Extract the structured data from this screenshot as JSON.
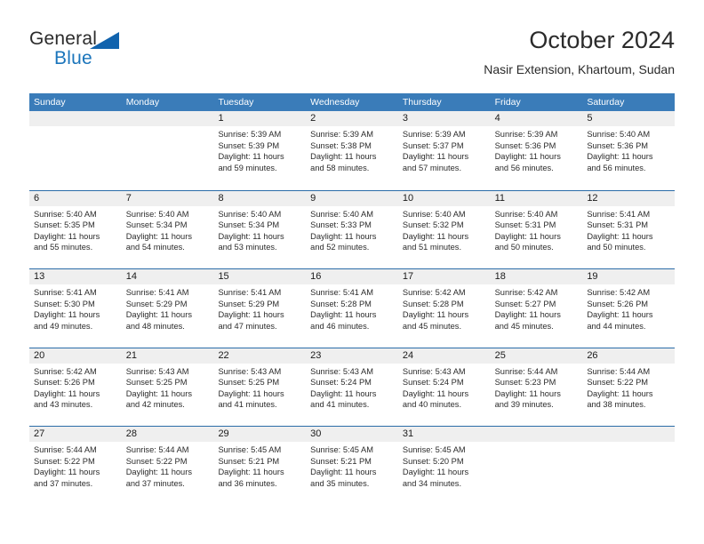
{
  "brand": {
    "name_part1": "General",
    "name_part2": "Blue",
    "triangle_color": "#1163ad",
    "blue_color": "#1b75bb"
  },
  "header": {
    "title": "October 2024",
    "subtitle": "Nasir Extension, Khartoum, Sudan"
  },
  "theme": {
    "header_row_bg": "#3a7cb9",
    "header_row_text": "#ffffff",
    "week_separator": "#2b6ca8",
    "day_band_bg": "#efefef",
    "body_text": "#2b2b2b"
  },
  "weekdays": [
    "Sunday",
    "Monday",
    "Tuesday",
    "Wednesday",
    "Thursday",
    "Friday",
    "Saturday"
  ],
  "weeks": [
    [
      {
        "day": "",
        "lines": []
      },
      {
        "day": "",
        "lines": []
      },
      {
        "day": "1",
        "lines": [
          "Sunrise: 5:39 AM",
          "Sunset: 5:39 PM",
          "Daylight: 11 hours",
          "and 59 minutes."
        ]
      },
      {
        "day": "2",
        "lines": [
          "Sunrise: 5:39 AM",
          "Sunset: 5:38 PM",
          "Daylight: 11 hours",
          "and 58 minutes."
        ]
      },
      {
        "day": "3",
        "lines": [
          "Sunrise: 5:39 AM",
          "Sunset: 5:37 PM",
          "Daylight: 11 hours",
          "and 57 minutes."
        ]
      },
      {
        "day": "4",
        "lines": [
          "Sunrise: 5:39 AM",
          "Sunset: 5:36 PM",
          "Daylight: 11 hours",
          "and 56 minutes."
        ]
      },
      {
        "day": "5",
        "lines": [
          "Sunrise: 5:40 AM",
          "Sunset: 5:36 PM",
          "Daylight: 11 hours",
          "and 56 minutes."
        ]
      }
    ],
    [
      {
        "day": "6",
        "lines": [
          "Sunrise: 5:40 AM",
          "Sunset: 5:35 PM",
          "Daylight: 11 hours",
          "and 55 minutes."
        ]
      },
      {
        "day": "7",
        "lines": [
          "Sunrise: 5:40 AM",
          "Sunset: 5:34 PM",
          "Daylight: 11 hours",
          "and 54 minutes."
        ]
      },
      {
        "day": "8",
        "lines": [
          "Sunrise: 5:40 AM",
          "Sunset: 5:34 PM",
          "Daylight: 11 hours",
          "and 53 minutes."
        ]
      },
      {
        "day": "9",
        "lines": [
          "Sunrise: 5:40 AM",
          "Sunset: 5:33 PM",
          "Daylight: 11 hours",
          "and 52 minutes."
        ]
      },
      {
        "day": "10",
        "lines": [
          "Sunrise: 5:40 AM",
          "Sunset: 5:32 PM",
          "Daylight: 11 hours",
          "and 51 minutes."
        ]
      },
      {
        "day": "11",
        "lines": [
          "Sunrise: 5:40 AM",
          "Sunset: 5:31 PM",
          "Daylight: 11 hours",
          "and 50 minutes."
        ]
      },
      {
        "day": "12",
        "lines": [
          "Sunrise: 5:41 AM",
          "Sunset: 5:31 PM",
          "Daylight: 11 hours",
          "and 50 minutes."
        ]
      }
    ],
    [
      {
        "day": "13",
        "lines": [
          "Sunrise: 5:41 AM",
          "Sunset: 5:30 PM",
          "Daylight: 11 hours",
          "and 49 minutes."
        ]
      },
      {
        "day": "14",
        "lines": [
          "Sunrise: 5:41 AM",
          "Sunset: 5:29 PM",
          "Daylight: 11 hours",
          "and 48 minutes."
        ]
      },
      {
        "day": "15",
        "lines": [
          "Sunrise: 5:41 AM",
          "Sunset: 5:29 PM",
          "Daylight: 11 hours",
          "and 47 minutes."
        ]
      },
      {
        "day": "16",
        "lines": [
          "Sunrise: 5:41 AM",
          "Sunset: 5:28 PM",
          "Daylight: 11 hours",
          "and 46 minutes."
        ]
      },
      {
        "day": "17",
        "lines": [
          "Sunrise: 5:42 AM",
          "Sunset: 5:28 PM",
          "Daylight: 11 hours",
          "and 45 minutes."
        ]
      },
      {
        "day": "18",
        "lines": [
          "Sunrise: 5:42 AM",
          "Sunset: 5:27 PM",
          "Daylight: 11 hours",
          "and 45 minutes."
        ]
      },
      {
        "day": "19",
        "lines": [
          "Sunrise: 5:42 AM",
          "Sunset: 5:26 PM",
          "Daylight: 11 hours",
          "and 44 minutes."
        ]
      }
    ],
    [
      {
        "day": "20",
        "lines": [
          "Sunrise: 5:42 AM",
          "Sunset: 5:26 PM",
          "Daylight: 11 hours",
          "and 43 minutes."
        ]
      },
      {
        "day": "21",
        "lines": [
          "Sunrise: 5:43 AM",
          "Sunset: 5:25 PM",
          "Daylight: 11 hours",
          "and 42 minutes."
        ]
      },
      {
        "day": "22",
        "lines": [
          "Sunrise: 5:43 AM",
          "Sunset: 5:25 PM",
          "Daylight: 11 hours",
          "and 41 minutes."
        ]
      },
      {
        "day": "23",
        "lines": [
          "Sunrise: 5:43 AM",
          "Sunset: 5:24 PM",
          "Daylight: 11 hours",
          "and 41 minutes."
        ]
      },
      {
        "day": "24",
        "lines": [
          "Sunrise: 5:43 AM",
          "Sunset: 5:24 PM",
          "Daylight: 11 hours",
          "and 40 minutes."
        ]
      },
      {
        "day": "25",
        "lines": [
          "Sunrise: 5:44 AM",
          "Sunset: 5:23 PM",
          "Daylight: 11 hours",
          "and 39 minutes."
        ]
      },
      {
        "day": "26",
        "lines": [
          "Sunrise: 5:44 AM",
          "Sunset: 5:22 PM",
          "Daylight: 11 hours",
          "and 38 minutes."
        ]
      }
    ],
    [
      {
        "day": "27",
        "lines": [
          "Sunrise: 5:44 AM",
          "Sunset: 5:22 PM",
          "Daylight: 11 hours",
          "and 37 minutes."
        ]
      },
      {
        "day": "28",
        "lines": [
          "Sunrise: 5:44 AM",
          "Sunset: 5:22 PM",
          "Daylight: 11 hours",
          "and 37 minutes."
        ]
      },
      {
        "day": "29",
        "lines": [
          "Sunrise: 5:45 AM",
          "Sunset: 5:21 PM",
          "Daylight: 11 hours",
          "and 36 minutes."
        ]
      },
      {
        "day": "30",
        "lines": [
          "Sunrise: 5:45 AM",
          "Sunset: 5:21 PM",
          "Daylight: 11 hours",
          "and 35 minutes."
        ]
      },
      {
        "day": "31",
        "lines": [
          "Sunrise: 5:45 AM",
          "Sunset: 5:20 PM",
          "Daylight: 11 hours",
          "and 34 minutes."
        ]
      },
      {
        "day": "",
        "lines": []
      },
      {
        "day": "",
        "lines": []
      }
    ]
  ]
}
